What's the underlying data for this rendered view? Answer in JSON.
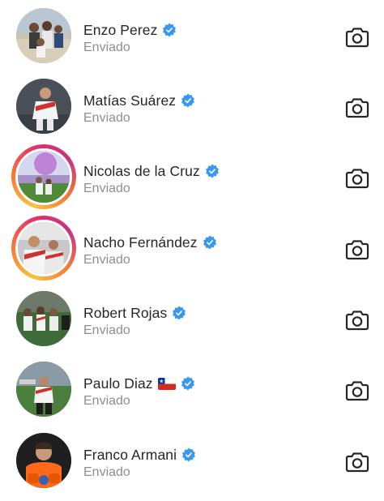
{
  "conversations": [
    {
      "name": "Enzo Perez",
      "flag": "",
      "status": "Enviado",
      "avatar": "avatar-group-beach",
      "story_ring": false
    },
    {
      "name": "Matías Suárez",
      "flag": "",
      "status": "Enviado",
      "avatar": "avatar-player-jersey",
      "story_ring": false
    },
    {
      "name": "Nicolas de la Cruz",
      "flag": "",
      "status": "Enviado",
      "avatar": "avatar-field-purple-sky",
      "story_ring": true
    },
    {
      "name": "Nacho Fernández",
      "flag": "",
      "status": "Enviado",
      "avatar": "avatar-celebration",
      "story_ring": true
    },
    {
      "name": "Robert Rojas",
      "flag": "",
      "status": "Enviado",
      "avatar": "avatar-team-huddle",
      "story_ring": false
    },
    {
      "name": "Paulo Diaz",
      "flag": "🇨🇱",
      "status": "Enviado",
      "avatar": "avatar-stadium",
      "story_ring": false
    },
    {
      "name": "Franco Armani",
      "flag": "",
      "status": "Enviado",
      "avatar": "avatar-goalkeeper",
      "story_ring": false
    }
  ],
  "icons": {
    "verified": "verified-badge-icon",
    "camera": "camera-icon",
    "flag_chile": "chile-flag-icon"
  },
  "colors": {
    "verified_blue": "#3897f0",
    "name_text": "#262626",
    "status_text": "#8e8e8e",
    "ring_yellow": "#f9c33b",
    "ring_pink": "#e1306c"
  }
}
